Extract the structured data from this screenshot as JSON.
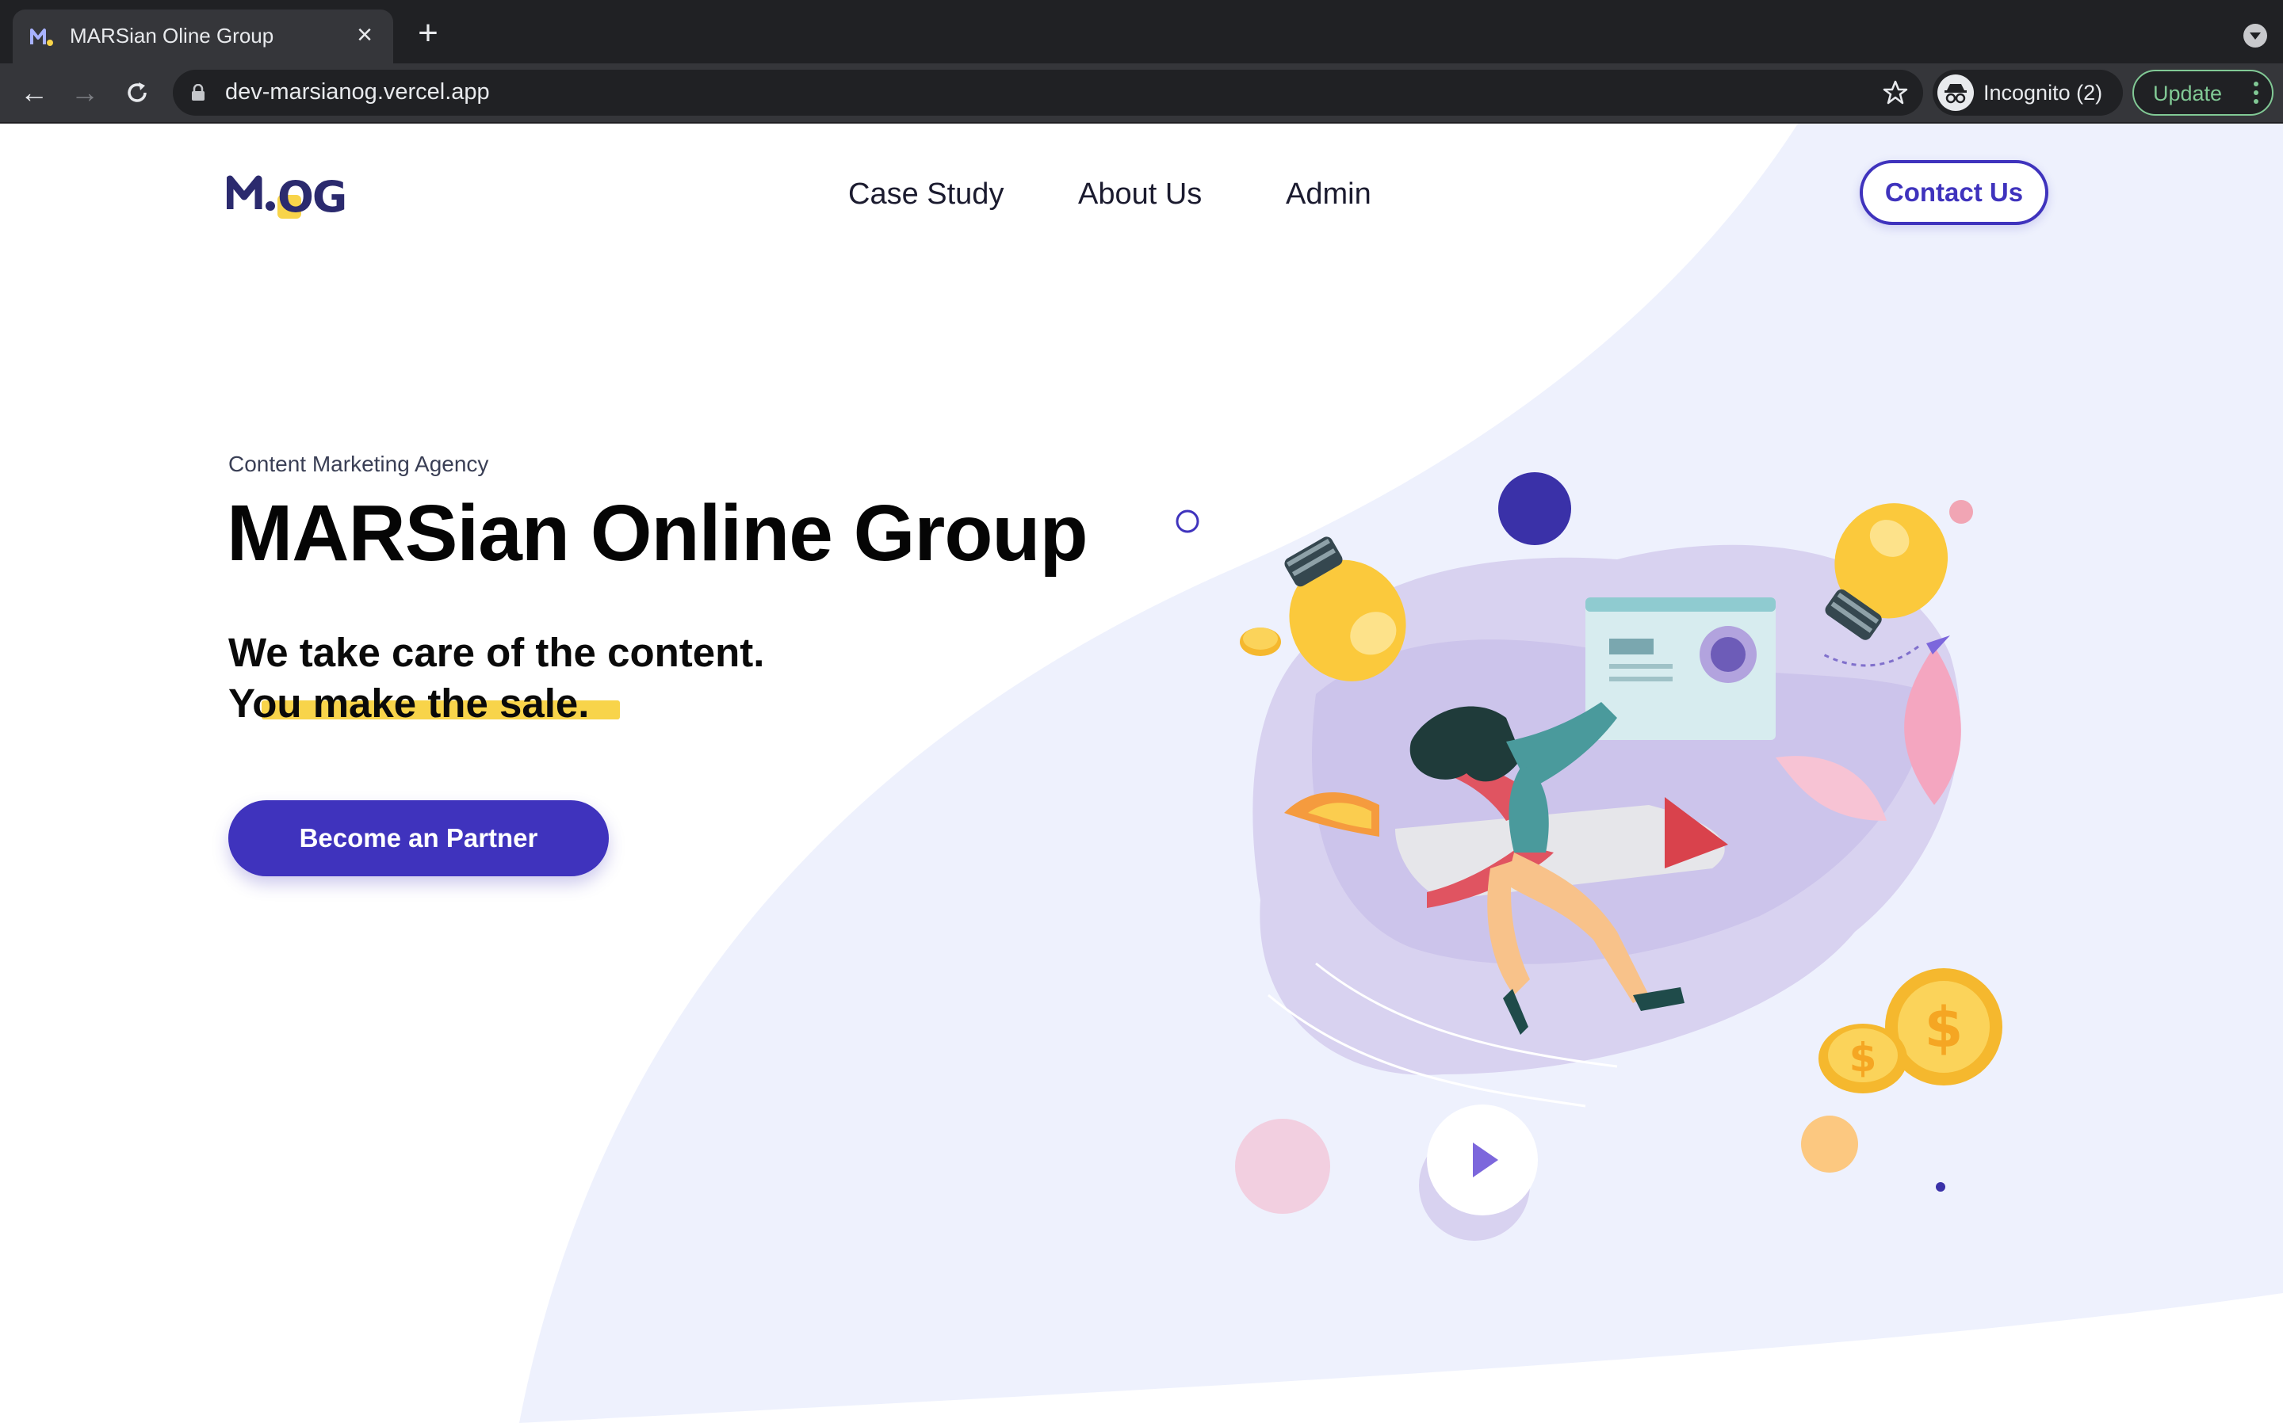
{
  "browser": {
    "tab_title": "MARSian Oline Group",
    "url": "dev-marsianog.vercel.app",
    "incognito_label": "Incognito (2)",
    "update_label": "Update",
    "icons": [
      "favicon-icon",
      "close-icon",
      "new-tab-icon",
      "tab-search-icon",
      "back-icon",
      "forward-icon",
      "reload-icon",
      "lock-icon",
      "star-icon",
      "incognito-icon",
      "menu-icon"
    ]
  },
  "site": {
    "logo_text": "MOG",
    "nav": {
      "case_study": "Case Study",
      "about_us": "About Us",
      "admin": "Admin"
    },
    "contact_label": "Contact Us"
  },
  "hero": {
    "eyebrow": "Content Marketing Agency",
    "title": "MARSian Online Group",
    "tagline_line1": "We take care of the content.",
    "tagline_line2": "You make the sale.",
    "cta_label": "Become an Partner"
  },
  "colors": {
    "brand": "#3f33bd",
    "highlight": "#f8d44a",
    "background_shape": "#eef1fd",
    "browser_dark": "#202124"
  }
}
